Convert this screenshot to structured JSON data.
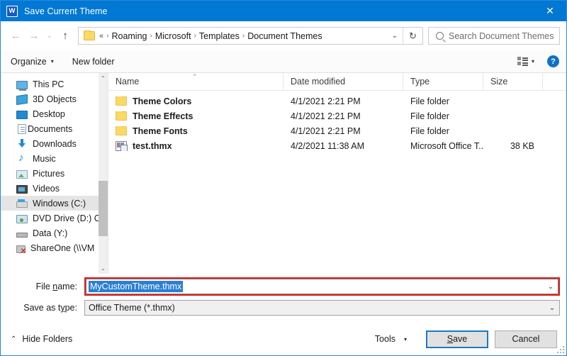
{
  "titlebar": {
    "app_icon": "word-icon",
    "title": "Save Current Theme",
    "close_label": "✕"
  },
  "navbar": {
    "back_icon": "←",
    "forward_icon": "→",
    "recent_icon": "⌄",
    "up_icon": "↑",
    "breadcrumb_prefix": "«",
    "breadcrumbs": [
      "Roaming",
      "Microsoft",
      "Templates",
      "Document Themes"
    ],
    "separator": "›",
    "dropdown_icon": "⌄",
    "refresh_icon": "↻",
    "search": {
      "icon": "search-icon",
      "placeholder": "Search Document Themes"
    }
  },
  "toolbar": {
    "organize_label": "Organize",
    "organize_caret": "▾",
    "new_folder_label": "New folder",
    "view_caret": "▾",
    "help_label": "?"
  },
  "sidebar": {
    "items": [
      {
        "label": "This PC",
        "icon": "pc-icon",
        "selected": false
      },
      {
        "label": "3D Objects",
        "icon": "3d-objects-icon",
        "selected": false
      },
      {
        "label": "Desktop",
        "icon": "desktop-icon",
        "selected": false
      },
      {
        "label": "Documents",
        "icon": "documents-icon",
        "selected": false
      },
      {
        "label": "Downloads",
        "icon": "downloads-icon",
        "selected": false
      },
      {
        "label": "Music",
        "icon": "music-icon",
        "selected": false
      },
      {
        "label": "Pictures",
        "icon": "pictures-icon",
        "selected": false
      },
      {
        "label": "Videos",
        "icon": "videos-icon",
        "selected": false
      },
      {
        "label": "Windows (C:)",
        "icon": "drive-icon",
        "selected": true
      },
      {
        "label": "DVD Drive (D:) C",
        "icon": "dvd-drive-icon",
        "selected": false
      },
      {
        "label": "Data (Y:)",
        "icon": "hard-disk-icon",
        "selected": false
      },
      {
        "label": "ShareOne (\\\\VM",
        "icon": "network-drive-icon",
        "selected": false
      }
    ],
    "scroll_up_icon": "⌃",
    "scroll_down_icon": "⌄"
  },
  "filelist": {
    "columns": [
      "Name",
      "Date modified",
      "Type",
      "Size"
    ],
    "sort_indicator": "⌃",
    "rows": [
      {
        "name": "Theme Colors",
        "date": "4/1/2021 2:21 PM",
        "type": "File folder",
        "size": "",
        "icon": "folder-icon"
      },
      {
        "name": "Theme Effects",
        "date": "4/1/2021 2:21 PM",
        "type": "File folder",
        "size": "",
        "icon": "folder-icon"
      },
      {
        "name": "Theme Fonts",
        "date": "4/1/2021 2:21 PM",
        "type": "File folder",
        "size": "",
        "icon": "folder-icon"
      },
      {
        "name": "test.thmx",
        "date": "4/2/2021 11:38 AM",
        "type": "Microsoft Office T...",
        "size": "38 KB",
        "icon": "thmx-file-icon"
      }
    ]
  },
  "fields": {
    "filename_label_pre": "File ",
    "filename_label_key": "n",
    "filename_label_post": "ame:",
    "filename_value": "MyCustomTheme.thmx",
    "filename_caret": "⌄",
    "savetype_label_pre": "Save as t",
    "savetype_label_key": "y",
    "savetype_label_post": "pe:",
    "savetype_value": "Office Theme (*.thmx)",
    "savetype_caret": "⌄"
  },
  "footer": {
    "hide_folders_chevron": "⌃",
    "hide_folders_label": "Hide Folders",
    "tools_label": "Tools",
    "tools_caret": "▾",
    "save_label_pre": "",
    "save_label_key": "S",
    "save_label_post": "ave",
    "cancel_label": "Cancel"
  },
  "colors": {
    "titlebar": "#0078d4",
    "selection": "#2a7fd4",
    "error_outline": "#e02020",
    "default_button_border": "#1b7ac2",
    "folder": "#fcd966"
  }
}
